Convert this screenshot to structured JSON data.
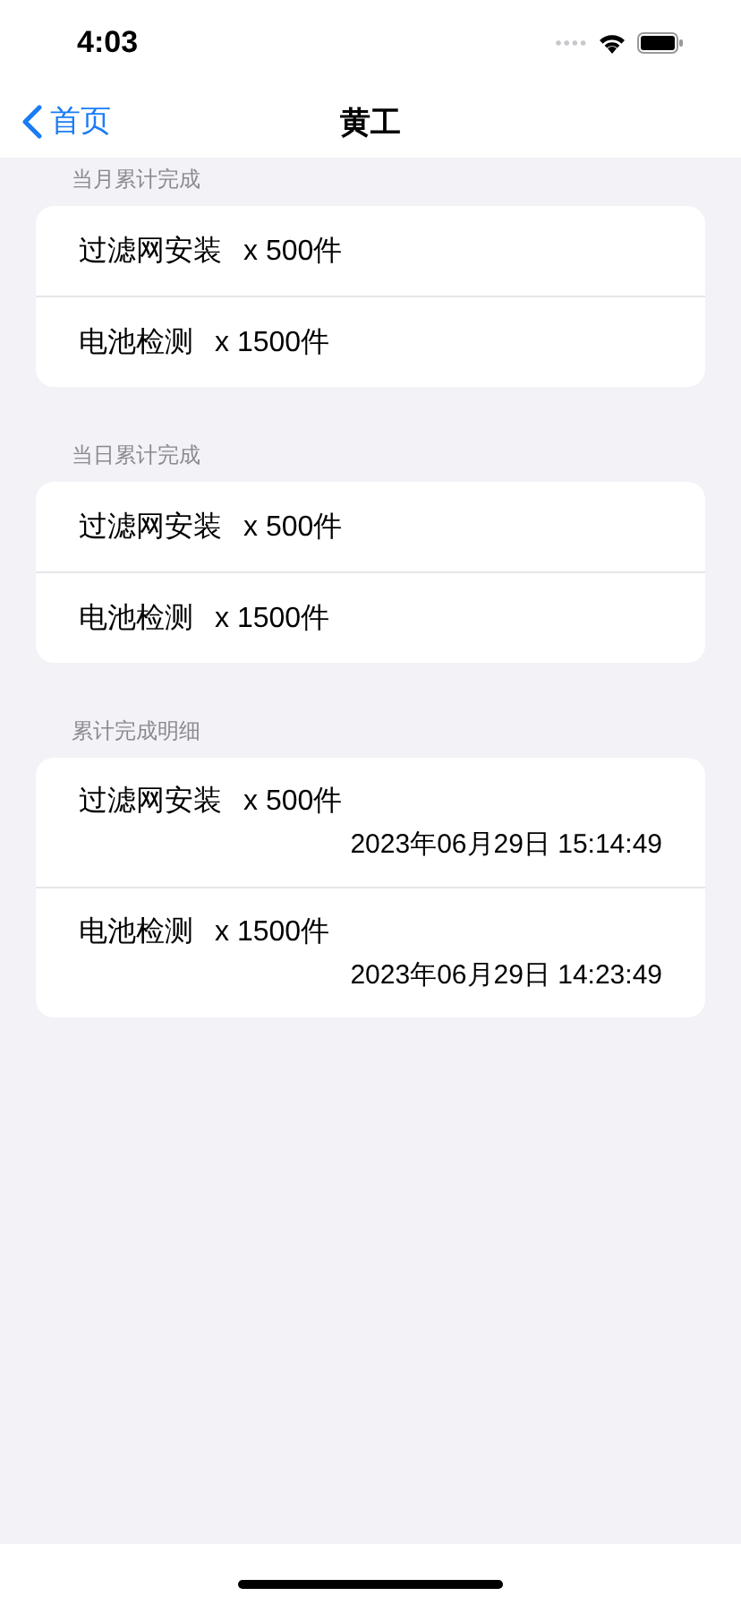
{
  "status_bar": {
    "time": "4:03"
  },
  "nav": {
    "back_label": "首页",
    "title": "黄工"
  },
  "sections": [
    {
      "header": "当月累计完成",
      "items": [
        {
          "name": "过滤网安装",
          "quantity": "x 500件"
        },
        {
          "name": "电池检测",
          "quantity": "x 1500件"
        }
      ]
    },
    {
      "header": "当日累计完成",
      "items": [
        {
          "name": "过滤网安装",
          "quantity": "x 500件"
        },
        {
          "name": "电池检测",
          "quantity": "x 1500件"
        }
      ]
    },
    {
      "header": "累计完成明细",
      "items": [
        {
          "name": "过滤网安装",
          "quantity": "x 500件",
          "time": "2023年06月29日 15:14:49"
        },
        {
          "name": "电池检测",
          "quantity": "x 1500件",
          "time": "2023年06月29日 14:23:49"
        }
      ]
    }
  ]
}
